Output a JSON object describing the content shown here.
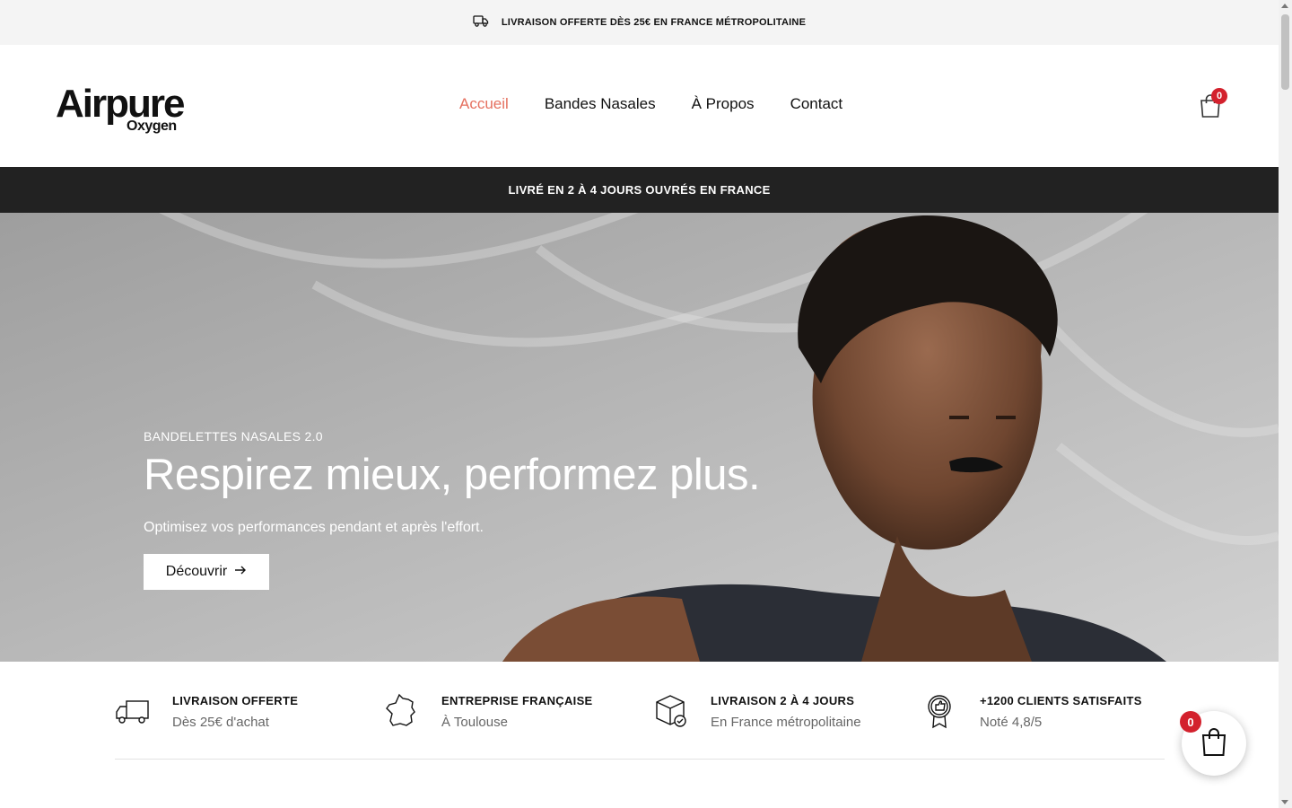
{
  "topbar": {
    "text": "LIVRAISON OFFERTE DÈS 25€ EN FRANCE MÉTROPOLITAINE",
    "icon": "truck-icon"
  },
  "header": {
    "logo": {
      "line1": "Airpure",
      "line2": "Oxygen"
    },
    "nav": [
      {
        "label": "Accueil",
        "active": true
      },
      {
        "label": "Bandes Nasales",
        "active": false
      },
      {
        "label": "À Propos",
        "active": false
      },
      {
        "label": "Contact",
        "active": false
      }
    ],
    "cart_count": "0"
  },
  "announcement": "LIVRÉ EN 2 À 4 JOURS OUVRÉS EN FRANCE",
  "hero": {
    "kicker": "BANDELETTES NASALES 2.0",
    "title": "Respirez mieux, performez plus.",
    "subtitle": "Optimisez vos performances pendant et après l'effort.",
    "cta": "Découvrir"
  },
  "features": [
    {
      "title": "LIVRAISON OFFERTE",
      "subtitle": "Dès 25€ d'achat",
      "icon": "delivery-truck-icon"
    },
    {
      "title": "ENTREPRISE FRANÇAISE",
      "subtitle": "À Toulouse",
      "icon": "france-map-icon"
    },
    {
      "title": "LIVRAISON 2 À 4 JOURS",
      "subtitle": "En France métropolitaine",
      "icon": "package-check-icon"
    },
    {
      "title": "+1200 CLIENTS SATISFAITS",
      "subtitle": "Noté 4,8/5",
      "icon": "award-thumbs-up-icon"
    }
  ],
  "floating_cart": {
    "count": "0"
  },
  "colors": {
    "accent": "#e5705f",
    "badge": "#d3212d",
    "announce_bg": "#222222",
    "topbar_bg": "#f4f4f4"
  }
}
